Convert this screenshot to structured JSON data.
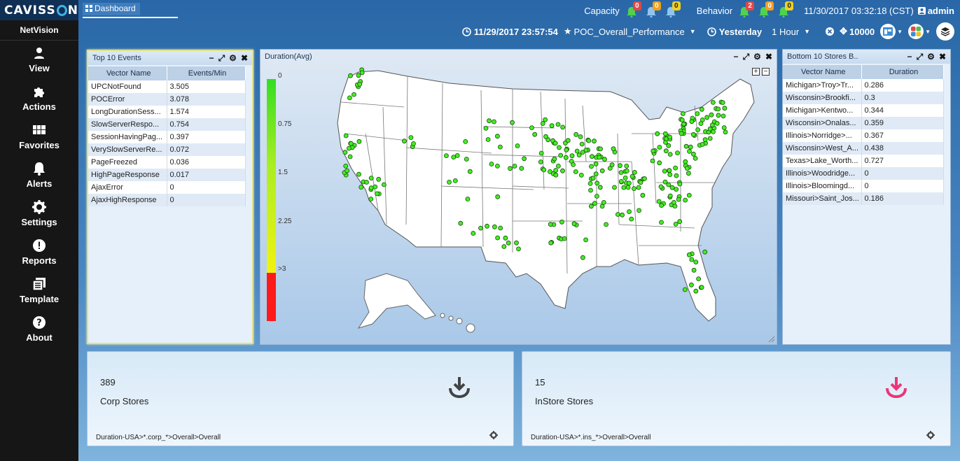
{
  "app": {
    "logo": "CAVISS",
    "logo_tail": "N",
    "product": "NetVision"
  },
  "sidebar": {
    "items": [
      {
        "label": "View",
        "icon": "user-icon"
      },
      {
        "label": "Actions",
        "icon": "puzzle-icon"
      },
      {
        "label": "Favorites",
        "icon": "grid-icon"
      },
      {
        "label": "Alerts",
        "icon": "bell-icon"
      },
      {
        "label": "Settings",
        "icon": "gear-icon"
      },
      {
        "label": "Reports",
        "icon": "exclamation-icon"
      },
      {
        "label": "Template",
        "icon": "template-icon"
      },
      {
        "label": "About",
        "icon": "question-icon"
      }
    ]
  },
  "header": {
    "tab": "Dashboard",
    "capacity_label": "Capacity",
    "capacity_badges": [
      "0",
      "0",
      "0"
    ],
    "behavior_label": "Behavior",
    "behavior_badges": [
      "2",
      "0",
      "0"
    ],
    "datetime": "11/30/2017 03:32:18 (CST)",
    "user": "admin",
    "start_time": "11/29/2017 23:57:54",
    "favorite": "POC_Overall_Performance",
    "period": "Yesterday",
    "interval": "1 Hour",
    "count": "10000",
    "colors": {
      "badge_red": "#e04848",
      "badge_orange": "#f0a020",
      "badge_yellow": "#f0d020",
      "bell": "#4fd24f"
    }
  },
  "top_events": {
    "title": "Top 10 Events",
    "columns": [
      "Vector Name",
      "Events/Min"
    ],
    "rows": [
      [
        "UPCNotFound",
        "3.505"
      ],
      [
        "POCError",
        "3.078"
      ],
      [
        "LongDurationSess...",
        "1.574"
      ],
      [
        "SlowServerRespo...",
        "0.754"
      ],
      [
        "SessionHavingPag...",
        "0.397"
      ],
      [
        "VerySlowServerRe...",
        "0.072"
      ],
      [
        "PageFreezed",
        "0.036"
      ],
      [
        "HighPageResponse",
        "0.017"
      ],
      [
        "AjaxError",
        "0"
      ],
      [
        "AjaxHighResponse",
        "0"
      ]
    ]
  },
  "map_panel": {
    "title": "Duration(Avg)",
    "legend": [
      "0",
      "0.75",
      "1.5",
      "2.25",
      ">3"
    ],
    "legend_colors": [
      "#33dd22",
      "#aaee22",
      "#f2f211",
      "#ff1a1a"
    ],
    "point_color": "#44ee22"
  },
  "bottom_stores": {
    "title": "Bottom 10 Stores B..",
    "columns": [
      "Vector Name",
      "Duration"
    ],
    "rows": [
      [
        "Michigan>Troy>Tr...",
        "0.286"
      ],
      [
        "Wisconsin>Brookfi...",
        "0.3"
      ],
      [
        "Michigan>Kentwo...",
        "0.344"
      ],
      [
        "Wisconsin>Onalas...",
        "0.359"
      ],
      [
        "Illinois>Norridge>...",
        "0.367"
      ],
      [
        "Wisconsin>West_A...",
        "0.438"
      ],
      [
        "Texas>Lake_Worth...",
        "0.727"
      ],
      [
        "Illinois>Woodridge...",
        "0"
      ],
      [
        "Illinois>Bloomingd...",
        "0"
      ],
      [
        "Missouri>Saint_Jos...",
        "0.186"
      ]
    ]
  },
  "kpis": [
    {
      "value": "389",
      "name": "Corp Stores",
      "path": "Duration-USA>*.corp_*>Overall>Overall",
      "icon_color": "#444444"
    },
    {
      "value": "15",
      "name": "InStore Stores",
      "path": "Duration-USA>*.ins_*>Overall>Overall",
      "icon_color": "#ee3377"
    }
  ]
}
